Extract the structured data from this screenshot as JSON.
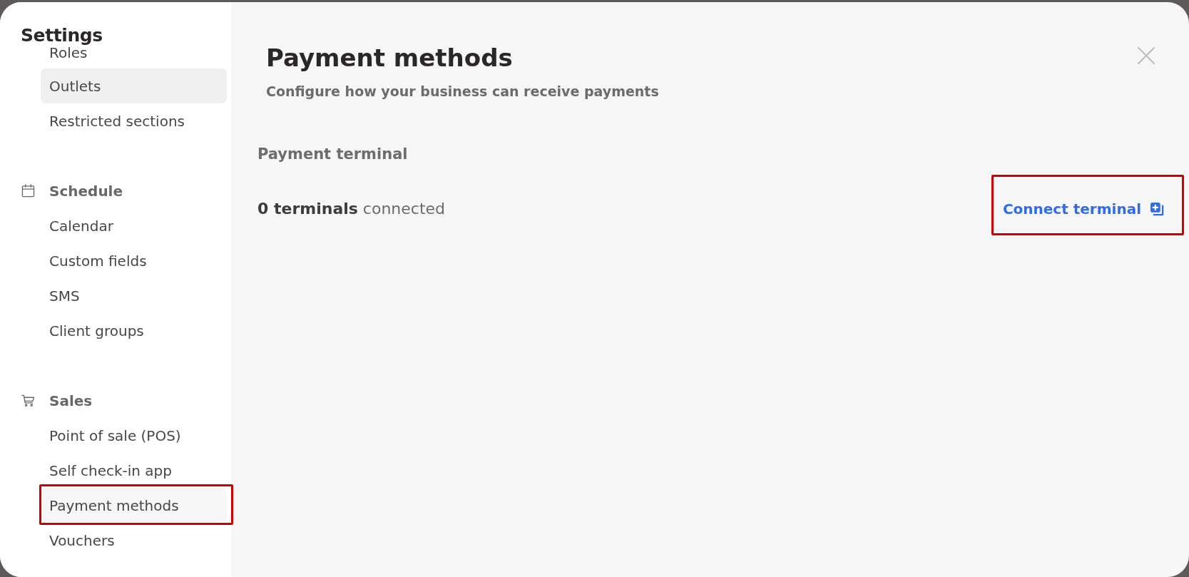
{
  "sidebar": {
    "title": "Settings",
    "sections": [
      {
        "items": [
          {
            "label": "Roles",
            "selected": false,
            "hovered": false,
            "highlighted": false
          },
          {
            "label": "Outlets",
            "selected": false,
            "hovered": true,
            "highlighted": false
          },
          {
            "label": "Restricted sections",
            "selected": false,
            "hovered": false,
            "highlighted": false
          }
        ]
      },
      {
        "title": "Schedule",
        "items": [
          {
            "label": "Calendar",
            "selected": false,
            "hovered": false,
            "highlighted": false
          },
          {
            "label": "Custom fields",
            "selected": false,
            "hovered": false,
            "highlighted": false
          },
          {
            "label": "SMS",
            "selected": false,
            "hovered": false,
            "highlighted": false
          },
          {
            "label": "Client groups",
            "selected": false,
            "hovered": false,
            "highlighted": false
          }
        ]
      },
      {
        "title": "Sales",
        "items": [
          {
            "label": "Point of sale (POS)",
            "selected": false,
            "hovered": false,
            "highlighted": false
          },
          {
            "label": "Self check-in app",
            "selected": false,
            "hovered": false,
            "highlighted": false
          },
          {
            "label": "Payment methods",
            "selected": true,
            "hovered": false,
            "highlighted": true
          },
          {
            "label": "Vouchers",
            "selected": false,
            "hovered": false,
            "highlighted": false
          }
        ]
      }
    ]
  },
  "page": {
    "title": "Payment methods",
    "subtitle": "Configure how your business can receive payments",
    "sections": [
      {
        "heading": "Payment terminal",
        "status": "**0 terminals** connected",
        "action": {
          "label": "Connect terminal",
          "highlighted": true
        }
      }
    ]
  }
}
